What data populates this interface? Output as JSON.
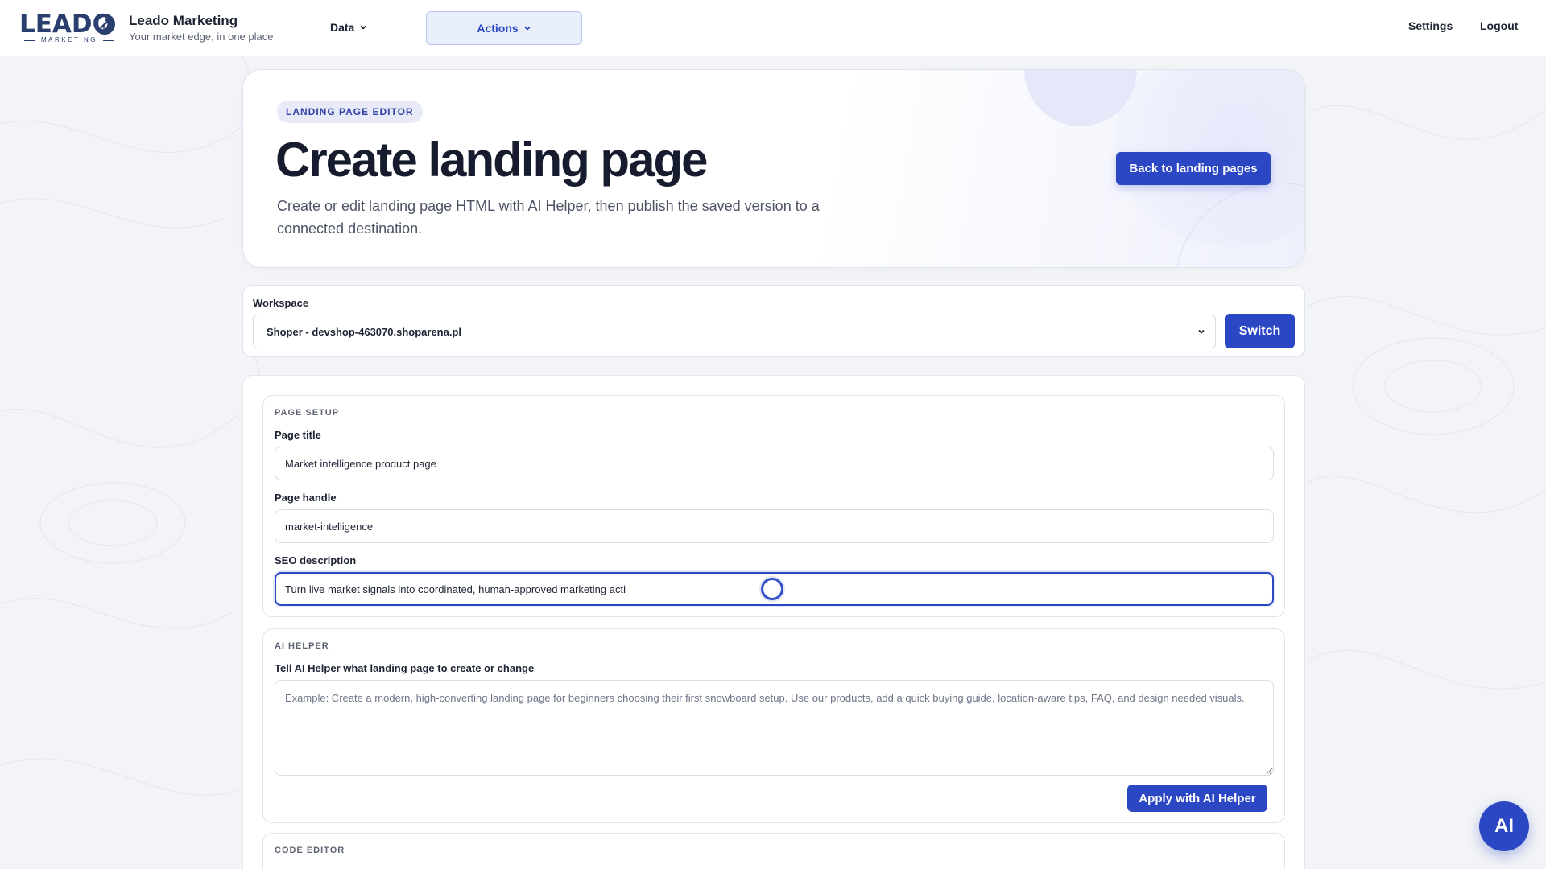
{
  "brand": {
    "logo_word": "LEADO",
    "logo_sub": "MARKETING",
    "name": "Leado Marketing",
    "tagline": "Your market edge, in one place",
    "color": "#2a3f6e"
  },
  "nav": {
    "data_label": "Data",
    "actions_label": "Actions",
    "settings_label": "Settings",
    "logout_label": "Logout",
    "accent": "#2b47c4"
  },
  "hero": {
    "badge": "LANDING PAGE EDITOR",
    "title": "Create landing page",
    "description": "Create or edit landing page HTML with AI Helper, then publish the saved version to a connected destination.",
    "back_button": "Back to landing pages"
  },
  "workspace": {
    "label": "Workspace",
    "selected": "Shoper - devshop-463070.shoparena.pl",
    "switch_button": "Switch"
  },
  "page_setup": {
    "heading": "PAGE SETUP",
    "title_label": "Page title",
    "title_value": "Market intelligence product page",
    "handle_label": "Page handle",
    "handle_value": "market-intelligence",
    "seo_label": "SEO description",
    "seo_value": "Turn live market signals into coordinated, human-approved marketing acti"
  },
  "ai_helper": {
    "heading": "AI HELPER",
    "prompt_label": "Tell AI Helper what landing page to create or change",
    "placeholder": "Example: Create a modern, high-converting landing page for beginners choosing their first snowboard setup. Use our products, add a quick buying guide, location-aware tips, FAQ, and design needed visuals.",
    "apply_button": "Apply with AI Helper"
  },
  "code_editor": {
    "heading": "CODE EDITOR"
  },
  "fab": {
    "label": "AI"
  }
}
